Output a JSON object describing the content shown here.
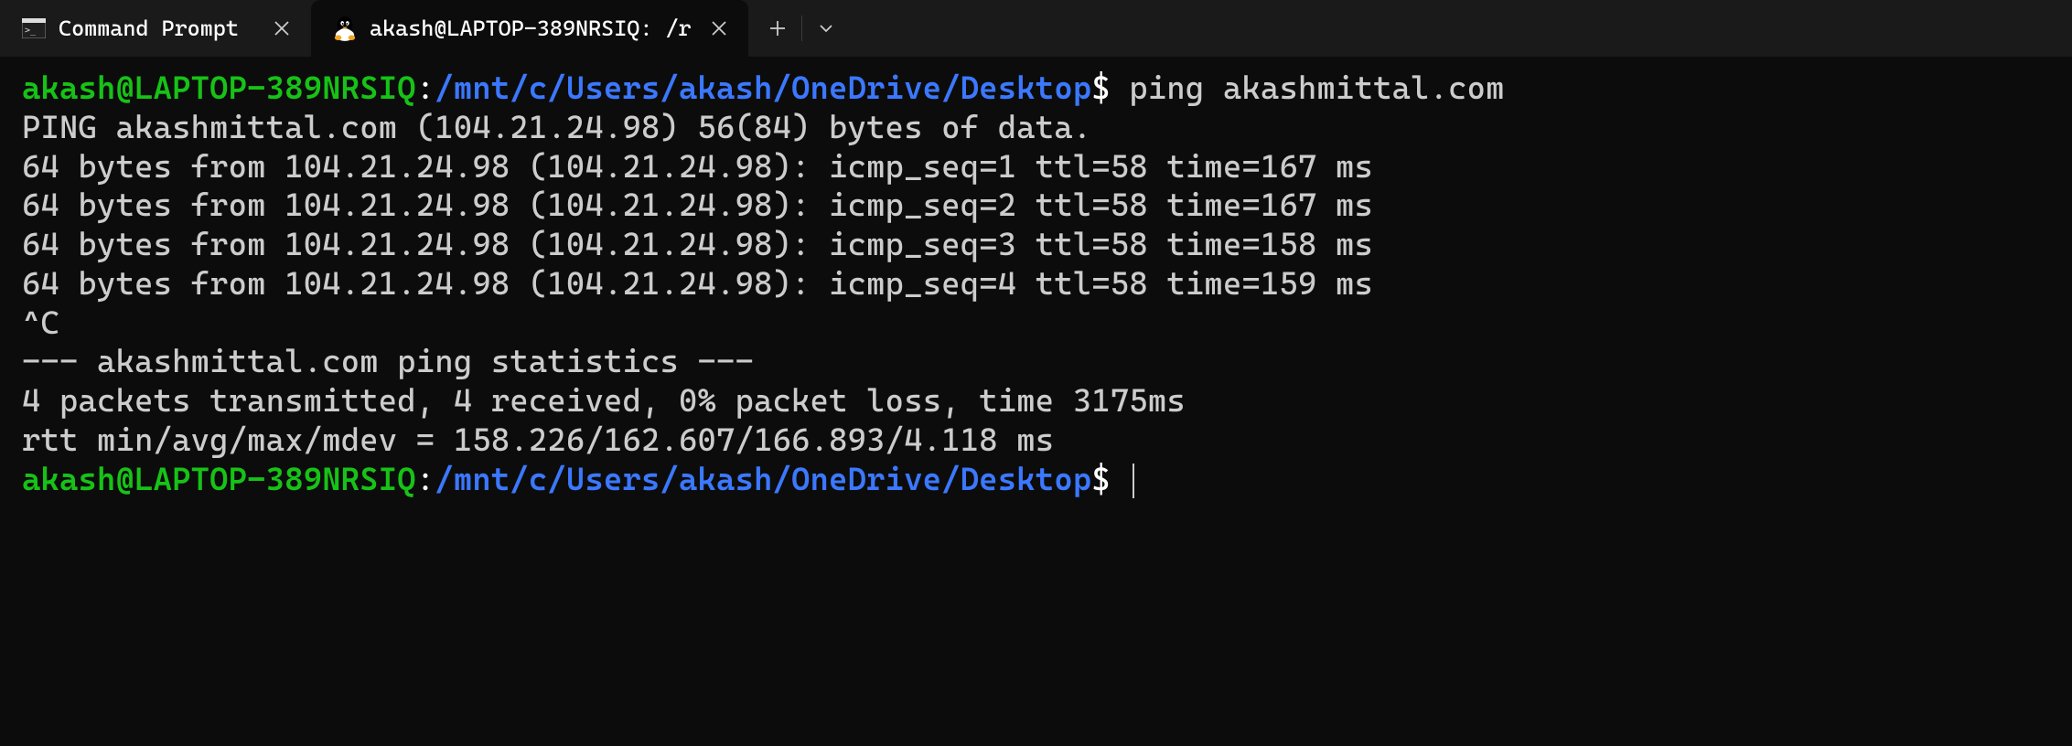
{
  "tabs": [
    {
      "label": "Command Prompt",
      "active": false
    },
    {
      "label": "akash@LAPTOP-389NRSIQ: /r",
      "active": true
    }
  ],
  "prompt": {
    "user": "akash@LAPTOP-389NRSIQ",
    "sep": ":",
    "path": "/mnt/c/Users/akash/OneDrive/Desktop",
    "sigil": "$"
  },
  "command": "ping akashmittal.com",
  "output": [
    "PING akashmittal.com (104.21.24.98) 56(84) bytes of data.",
    "64 bytes from 104.21.24.98 (104.21.24.98): icmp_seq=1 ttl=58 time=167 ms",
    "64 bytes from 104.21.24.98 (104.21.24.98): icmp_seq=2 ttl=58 time=167 ms",
    "64 bytes from 104.21.24.98 (104.21.24.98): icmp_seq=3 ttl=58 time=158 ms",
    "64 bytes from 104.21.24.98 (104.21.24.98): icmp_seq=4 ttl=58 time=159 ms",
    "^C",
    "--- akashmittal.com ping statistics ---",
    "4 packets transmitted, 4 received, 0% packet loss, time 3175ms",
    "rtt min/avg/max/mdev = 158.226/162.607/166.893/4.118 ms"
  ]
}
